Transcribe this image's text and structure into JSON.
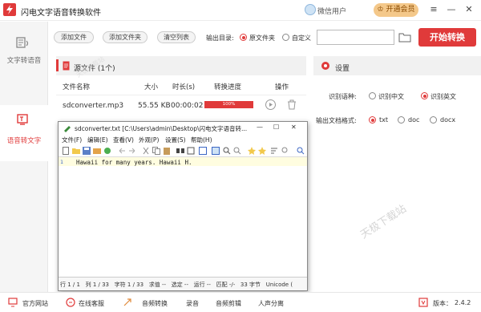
{
  "app": {
    "title": "闪电文字语音转换软件",
    "user": "微信用户",
    "vip": "开通会员"
  },
  "window_controls": {
    "menu": "≡",
    "minimize": "—",
    "close": "✕"
  },
  "sidebar": {
    "items": [
      {
        "label": "文字转语音"
      },
      {
        "label": "语音转文字"
      }
    ]
  },
  "toolbar": {
    "add_file": "添加文件",
    "add_folder": "添加文件夹",
    "clear_list": "清空列表",
    "output_label": "输出目录:",
    "output_options": [
      "原文件夹",
      "自定义"
    ],
    "start": "开始转换"
  },
  "source": {
    "title": "源文件 (1个)",
    "columns": [
      "文件名称",
      "大小",
      "时长(s)",
      "转换进度",
      "操作"
    ],
    "rows": [
      {
        "name": "sdconverter.mp3",
        "size": "55.55 KB",
        "duration": "00:00:02",
        "progress": "100%",
        "progress_value": 1.0
      }
    ]
  },
  "settings": {
    "title": "设置",
    "lang_label": "识别语种:",
    "lang_options": [
      "识别中文",
      "识别英文"
    ],
    "lang_selected": "识别英文",
    "fmt_label": "输出文档格式:",
    "fmt_options": [
      "txt",
      "doc",
      "docx"
    ],
    "fmt_selected": "txt"
  },
  "notepad": {
    "title": "sdconverter.txt [C:\\Users\\admin\\Desktop\\闪电文字语音转...",
    "menus": [
      "文件(F)",
      "编辑(E)",
      "查看(V)",
      "外观(P)",
      "设置(S)",
      "帮助(H)"
    ],
    "line_number": "1",
    "content": "Hawaii for many years. Hawaii H.",
    "status": "行 1 / 1   列 1 / 33   字符 1 / 33   求值 --   选定 --   运行 --   匹配 -/-   33 字节   Unicode ("
  },
  "watermark": "天极下载站",
  "watermark_small": "天极下载站",
  "footer": {
    "items": [
      "官方网站",
      "在线客服",
      "音频转换",
      "录音",
      "音频剪辑",
      "人声分离"
    ],
    "version_label": "版本：",
    "version": "2.4.2"
  },
  "colors": {
    "accent": "#e03a3a",
    "vip": "#f4c88a"
  }
}
